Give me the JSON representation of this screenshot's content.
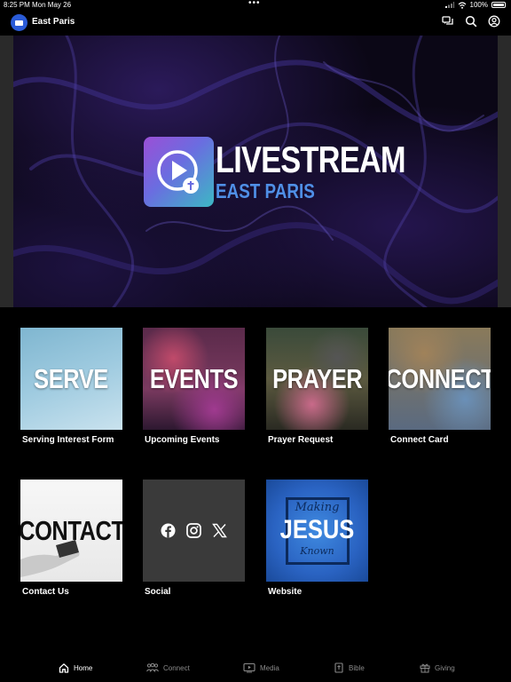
{
  "status_bar": {
    "time": "8:25 PM",
    "date": "Mon May 26",
    "battery": "100%"
  },
  "header": {
    "church_name": "East Paris"
  },
  "hero": {
    "title": "LIVESTREAM",
    "subtitle": "EAST PARIS"
  },
  "tiles": [
    {
      "word": "SERVE",
      "label": "Serving Interest Form"
    },
    {
      "word": "EVENTS",
      "label": "Upcoming Events"
    },
    {
      "word": "PRAYER",
      "label": "Prayer Request"
    },
    {
      "word": "CONNECT",
      "label": "Connect Card"
    },
    {
      "word": "CONTACT",
      "label": "Contact Us"
    },
    {
      "word": "",
      "label": "Social"
    },
    {
      "word": "",
      "label": "Website"
    }
  ],
  "website_art": {
    "line1": "Making",
    "line2": "JESUS",
    "line3": "Known"
  },
  "tabbar": [
    {
      "label": "Home",
      "icon": "home-icon",
      "active": true
    },
    {
      "label": "Connect",
      "icon": "people-icon",
      "active": false
    },
    {
      "label": "Media",
      "icon": "play-screen-icon",
      "active": false
    },
    {
      "label": "Bible",
      "icon": "bible-icon",
      "active": false
    },
    {
      "label": "Giving",
      "icon": "gift-icon",
      "active": false
    }
  ],
  "colors": {
    "background": "#000000",
    "accent_blue": "#4f8fe6",
    "tab_inactive": "#8a8a8a"
  }
}
